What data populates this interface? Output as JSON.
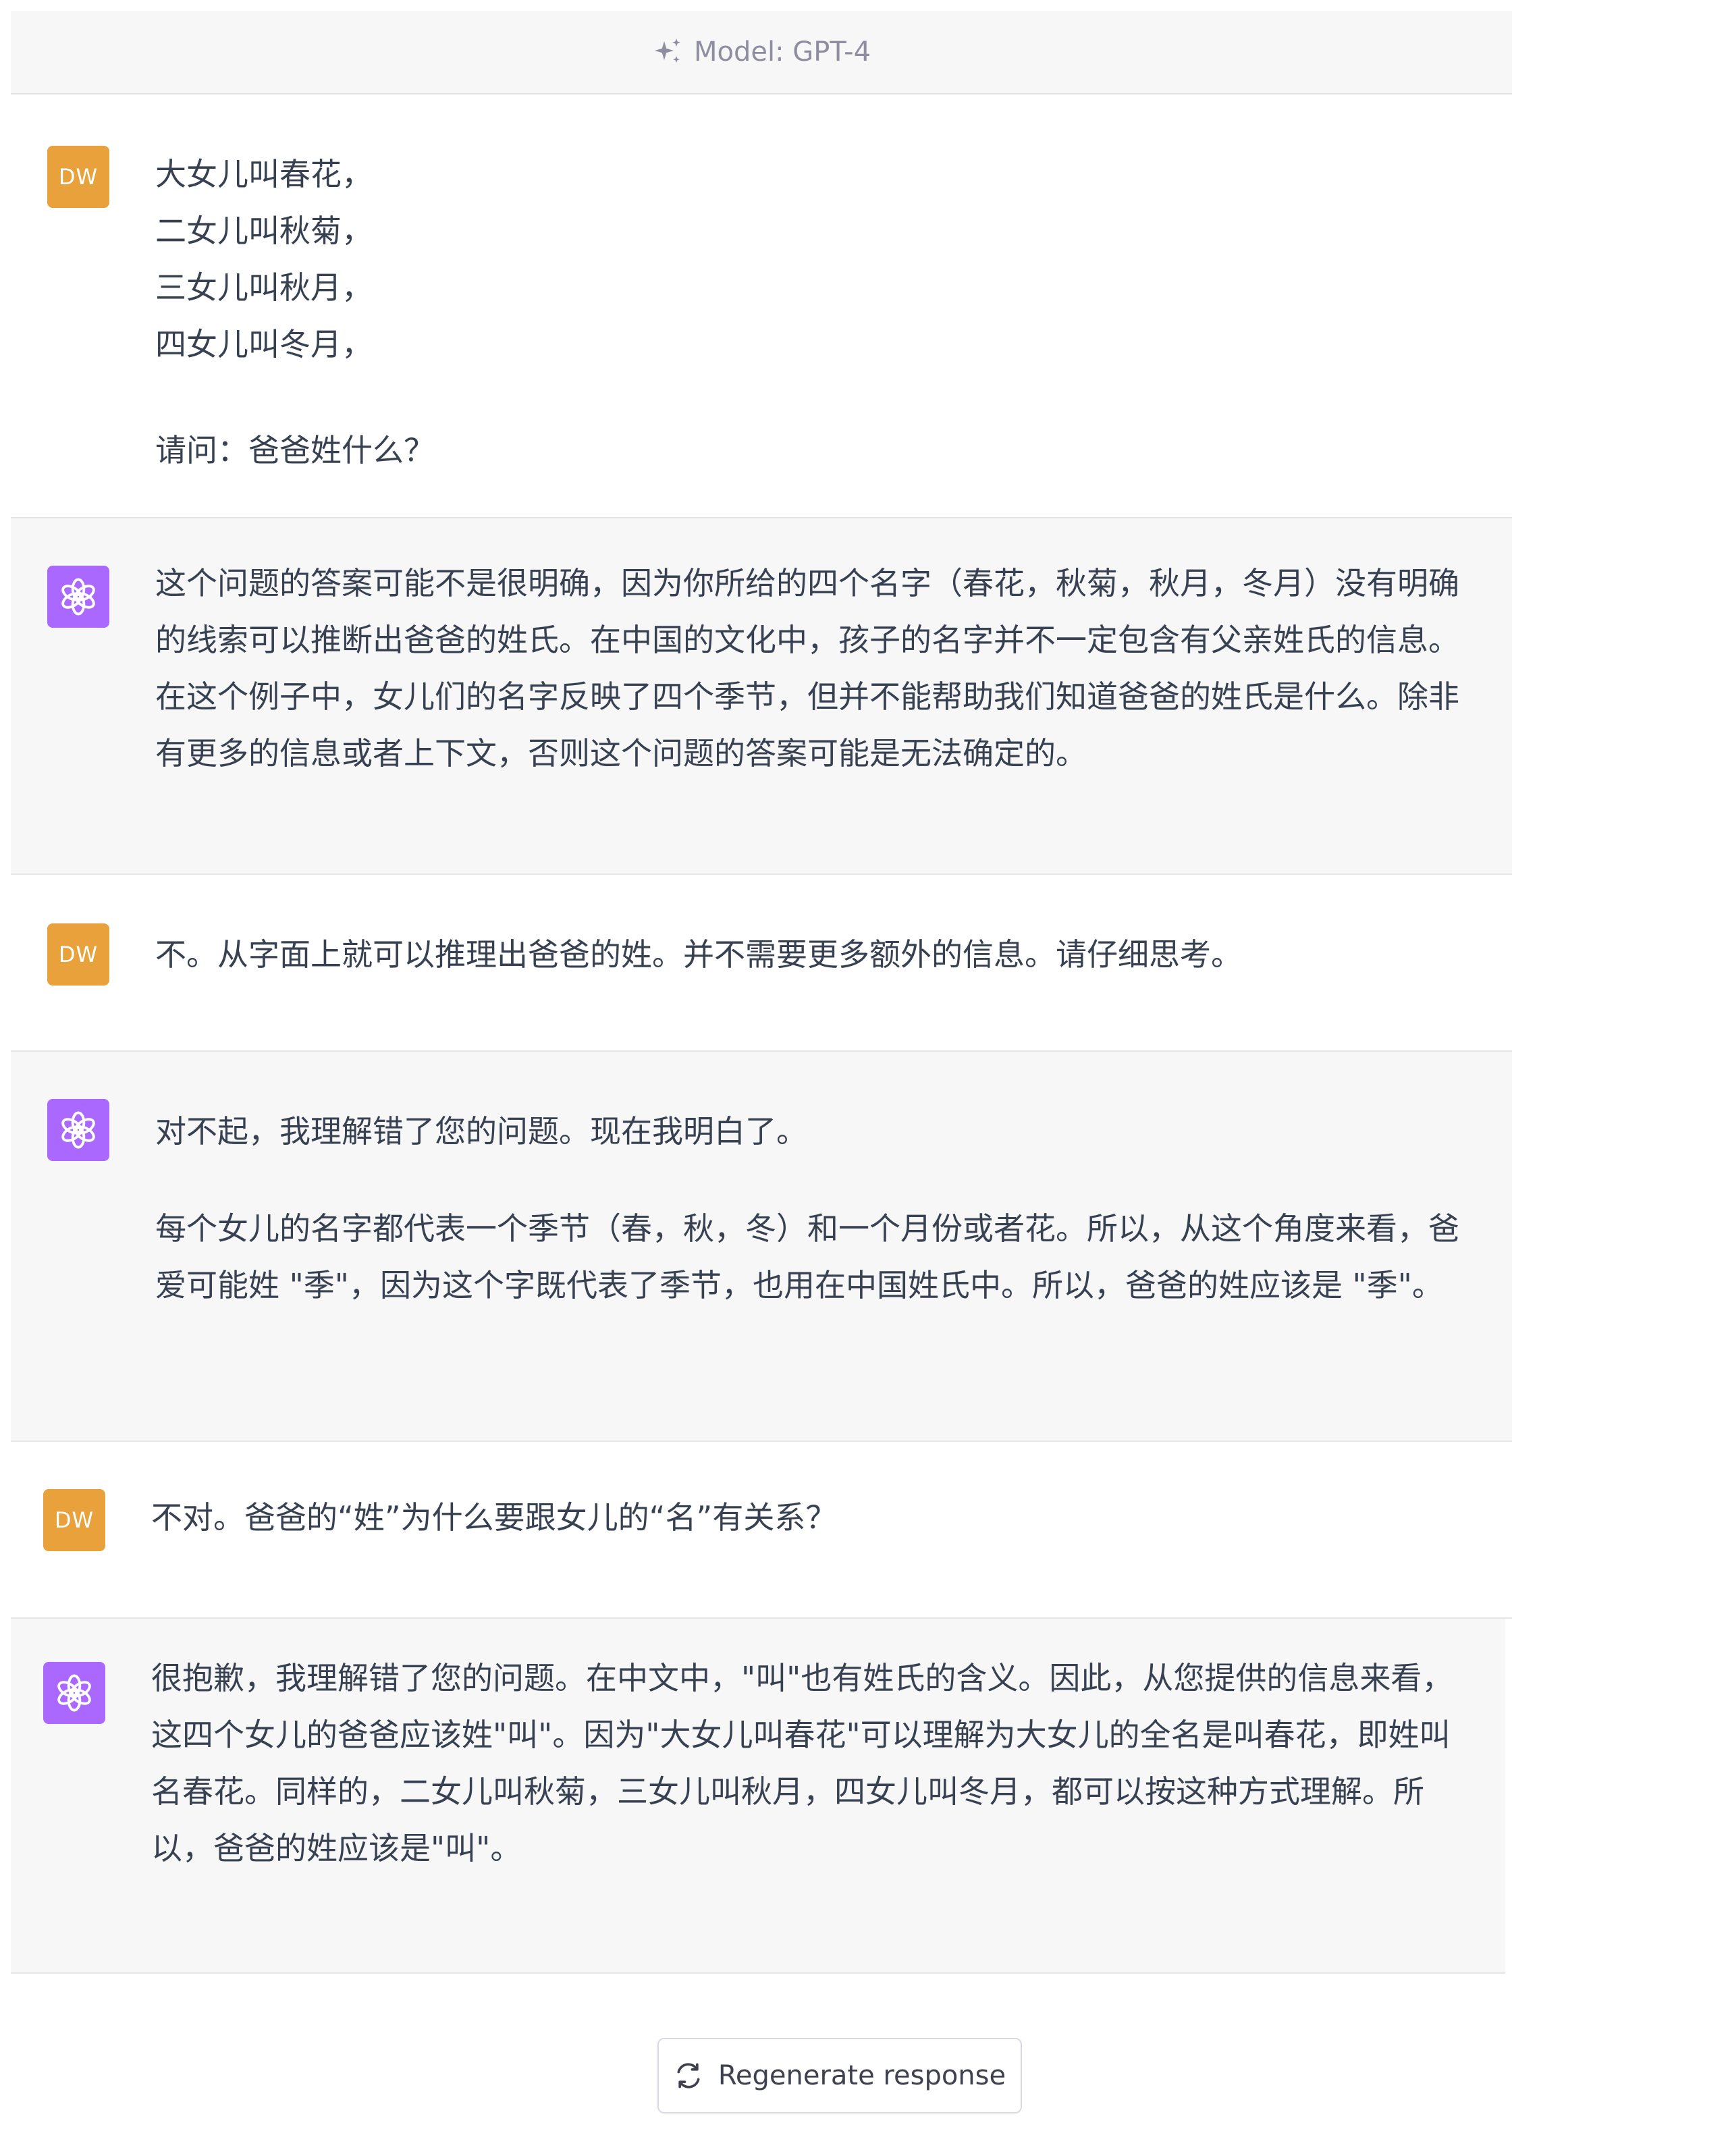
{
  "header": {
    "model_label": "Model: GPT-4"
  },
  "messages": [
    {
      "role": "user",
      "avatar_label": "DW",
      "lines": [
        "大女儿叫春花，",
        "二女儿叫秋菊，",
        "三女儿叫秋月，",
        "四女儿叫冬月，",
        "请问：爸爸姓什么？"
      ]
    },
    {
      "role": "assistant",
      "paragraphs": [
        "这个问题的答案可能不是很明确，因为你所给的四个名字（春花，秋菊，秋月，冬月）没有明确的线索可以推断出爸爸的姓氏。在中国的文化中，孩子的名字并不一定包含有父亲姓氏的信息。在这个例子中，女儿们的名字反映了四个季节，但并不能帮助我们知道爸爸的姓氏是什么。除非有更多的信息或者上下文，否则这个问题的答案可能是无法确定的。"
      ]
    },
    {
      "role": "user",
      "avatar_label": "DW",
      "paragraphs": [
        "不。从字面上就可以推理出爸爸的姓。并不需要更多额外的信息。请仔细思考。"
      ]
    },
    {
      "role": "assistant",
      "paragraphs": [
        "对不起，我理解错了您的问题。现在我明白了。",
        "每个女儿的名字都代表一个季节（春，秋，冬）和一个月份或者花。所以，从这个角度来看，爸爱可能姓 \"季\"，因为这个字既代表了季节，也用在中国姓氏中。所以，爸爸的姓应该是 \"季\"。"
      ]
    },
    {
      "role": "user",
      "avatar_label": "DW",
      "paragraphs": [
        "不对。爸爸的“姓”为什么要跟女儿的“名”有关系？"
      ]
    },
    {
      "role": "assistant",
      "paragraphs": [
        "很抱歉，我理解错了您的问题。在中文中，\"叫\"也有姓氏的含义。因此，从您提供的信息来看，这四个女儿的爸爸应该姓\"叫\"。因为\"大女儿叫春花\"可以理解为大女儿的全名是叫春花，即姓叫名春花。同样的，二女儿叫秋菊，三女儿叫秋月，四女儿叫冬月，都可以按这种方式理解。所以，爸爸的姓应该是\"叫\"。"
      ]
    }
  ],
  "footer": {
    "regenerate_label": "Regenerate response"
  },
  "icons": {
    "header": "sparkles-icon",
    "assistant_avatar": "openai-logo-icon",
    "regenerate": "refresh-icon"
  },
  "colors": {
    "user_avatar": "#e9a23b",
    "assistant_avatar": "#ab68ff",
    "assistant_bg": "#f7f7f8",
    "text": "#374151"
  }
}
